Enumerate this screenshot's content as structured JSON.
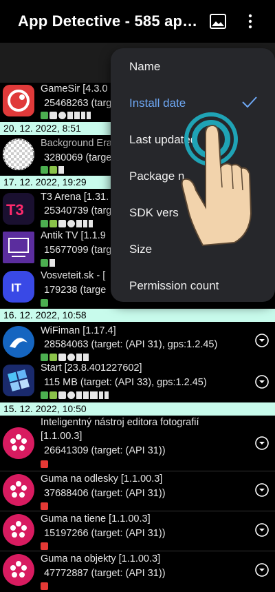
{
  "appbar": {
    "title": "App Detective - 585 ap…",
    "image_icon": "image-icon",
    "more_icon": "more-vert-icon"
  },
  "sort_menu": {
    "items": [
      {
        "label": "Name",
        "selected": false
      },
      {
        "label": "Install date",
        "selected": true
      },
      {
        "label": "Last updated",
        "selected": false
      },
      {
        "label": "Package n",
        "selected": false
      },
      {
        "label": "SDK vers",
        "selected": false
      },
      {
        "label": "Size",
        "selected": false
      },
      {
        "label": "Permission count",
        "selected": false
      }
    ],
    "selected_color": "#6ea8f5"
  },
  "groups": [
    {
      "date": "20. 12. 2022, 8:51"
    },
    {
      "date": "17. 12. 2022, 19:29"
    },
    {
      "date": "16. 12. 2022, 10:58"
    },
    {
      "date": "15. 12. 2022, 10:50"
    }
  ],
  "apps": [
    {
      "name": "GameSir [4.3.0",
      "meta": "25468263 (targ"
    },
    {
      "name": "Background Era",
      "meta": "3280069 (targe"
    },
    {
      "name": "T3 Arena [1.31.",
      "meta": "25340739 (targ"
    },
    {
      "name": "Antik TV [1.1.9",
      "meta": "15677099 (targ"
    },
    {
      "name": "Vosveteit.sk - [",
      "meta": "179238 (targe"
    },
    {
      "name": "WiFiman [1.17.4]",
      "meta": "28584063 (target: (API 31), gps:1.2.45)"
    },
    {
      "name": "Start [23.8.401227602]",
      "meta": "115 MB (target: (API 33), gps:1.2.45)"
    },
    {
      "name": "Inteligentný nástroj editora fotografií",
      "name2": "[1.1.00.3]",
      "meta": "26641309 (target: (API 31))"
    },
    {
      "name": "Guma na odlesky [1.1.00.3]",
      "meta": "37688406 (target: (API 31))"
    },
    {
      "name": "Guma na tiene [1.1.00.3]",
      "meta": "15197266 (target: (API 31))"
    },
    {
      "name": "Guma na objekty [1.1.00.3]",
      "meta": "47772887 (target: (API 31))"
    }
  ],
  "colors": {
    "date_header_bg": "#c8fbec",
    "menu_bg": "#26272b",
    "accent": "#6ea8f5"
  }
}
